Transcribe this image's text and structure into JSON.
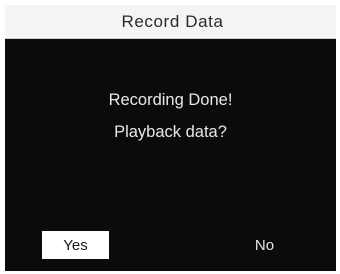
{
  "header": {
    "title": "Record Data"
  },
  "dialog": {
    "line1": "Recording Done!",
    "line2": "Playback data?"
  },
  "buttons": {
    "yes_label": "Yes",
    "no_label": "No",
    "selected": "Yes"
  },
  "colors": {
    "screen_background": "#0b0b0b",
    "title_bar_background": "#f4f4f4",
    "text_light": "#e8e8e8",
    "selected_button_background": "#ffffff"
  }
}
